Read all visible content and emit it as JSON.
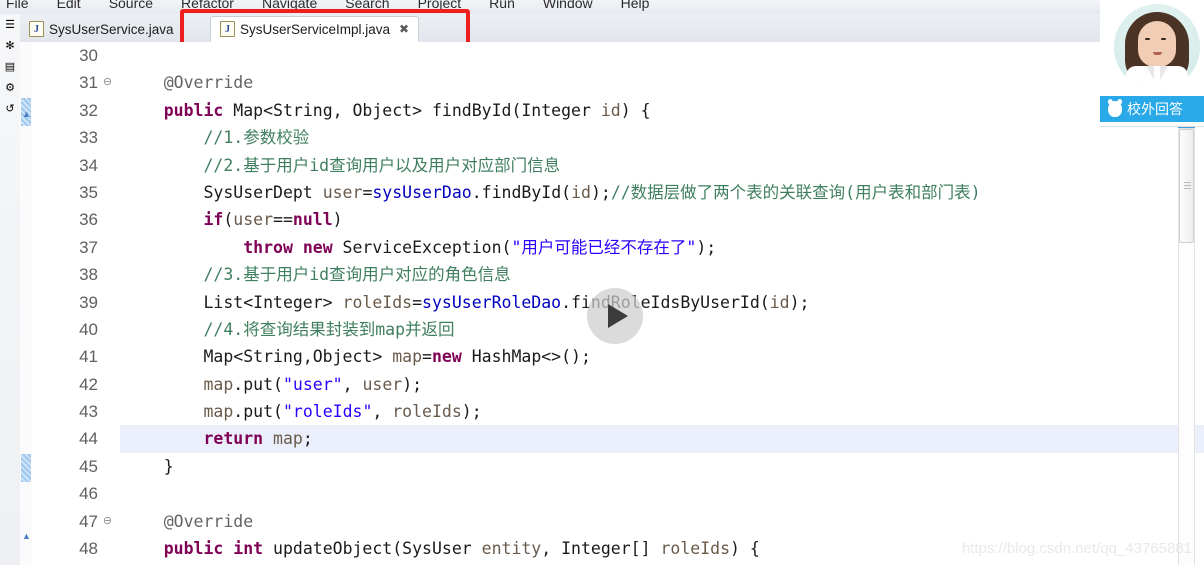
{
  "menubar": {
    "items": [
      "File",
      "Edit",
      "Source",
      "Refactor",
      "Navigate",
      "Search",
      "Project",
      "Run",
      "Window",
      "Help"
    ]
  },
  "rail": {
    "icons": [
      "package-explorer-icon",
      "bug-icon",
      "open-type-icon",
      "java-browsing-icon",
      "undo-icon"
    ],
    "glyphs": [
      "☰",
      "✻",
      "▤",
      "⚙",
      "↺"
    ]
  },
  "tabs": [
    {
      "label": "SysUserService.java",
      "icon": "java-file-icon",
      "icon_glyph": "J",
      "active": false,
      "closable": false
    },
    {
      "label": "SysUserServiceImpl.java",
      "icon": "java-file-icon",
      "icon_glyph": "J",
      "active": true,
      "closable": true,
      "close_glyph": "✖"
    }
  ],
  "annotation": {
    "highlight_color": "#ef1f1f",
    "target": "SysUserServiceImpl.java"
  },
  "editor": {
    "current_line": 44,
    "lines": [
      {
        "n": "30",
        "fold": "",
        "tokens": []
      },
      {
        "n": "31",
        "fold": "⊖",
        "tokens": [
          {
            "t": "    ",
            "c": "pln"
          },
          {
            "t": "@Override",
            "c": "ann"
          }
        ]
      },
      {
        "n": "32",
        "fold": "",
        "tokens": [
          {
            "t": "    ",
            "c": "pln"
          },
          {
            "t": "public",
            "c": "kw"
          },
          {
            "t": " Map<String, Object> findById(",
            "c": "pln"
          },
          {
            "t": "Integer",
            "c": "pln"
          },
          {
            "t": " ",
            "c": "pln"
          },
          {
            "t": "id",
            "c": "var"
          },
          {
            "t": ") {",
            "c": "pln"
          }
        ]
      },
      {
        "n": "33",
        "fold": "",
        "tokens": [
          {
            "t": "        ",
            "c": "pln"
          },
          {
            "t": "//1.参数校验",
            "c": "cm"
          }
        ]
      },
      {
        "n": "34",
        "fold": "",
        "tokens": [
          {
            "t": "        ",
            "c": "pln"
          },
          {
            "t": "//2.基于用户id查询用户以及用户对应部门信息",
            "c": "cm"
          }
        ]
      },
      {
        "n": "35",
        "fold": "",
        "tokens": [
          {
            "t": "        SysUserDept ",
            "c": "pln"
          },
          {
            "t": "user",
            "c": "var"
          },
          {
            "t": "=",
            "c": "pln"
          },
          {
            "t": "sysUserDao",
            "c": "fld"
          },
          {
            "t": ".findById(",
            "c": "pln"
          },
          {
            "t": "id",
            "c": "var"
          },
          {
            "t": ");",
            "c": "pln"
          },
          {
            "t": "//数据层做了两个表的关联查询(用户表和部门表)",
            "c": "cm"
          }
        ]
      },
      {
        "n": "36",
        "fold": "",
        "tokens": [
          {
            "t": "        ",
            "c": "pln"
          },
          {
            "t": "if",
            "c": "kw"
          },
          {
            "t": "(",
            "c": "pln"
          },
          {
            "t": "user",
            "c": "var"
          },
          {
            "t": "==",
            "c": "pln"
          },
          {
            "t": "null",
            "c": "kw"
          },
          {
            "t": ")",
            "c": "pln"
          }
        ]
      },
      {
        "n": "37",
        "fold": "",
        "tokens": [
          {
            "t": "            ",
            "c": "pln"
          },
          {
            "t": "throw new",
            "c": "kw"
          },
          {
            "t": " ServiceException(",
            "c": "pln"
          },
          {
            "t": "\"用户可能已经不存在了\"",
            "c": "str"
          },
          {
            "t": ");",
            "c": "pln"
          }
        ]
      },
      {
        "n": "38",
        "fold": "",
        "tokens": [
          {
            "t": "        ",
            "c": "pln"
          },
          {
            "t": "//3.基于用户id查询用户对应的角色信息",
            "c": "cm"
          }
        ]
      },
      {
        "n": "39",
        "fold": "",
        "tokens": [
          {
            "t": "        List<Integer> ",
            "c": "pln"
          },
          {
            "t": "roleIds",
            "c": "var"
          },
          {
            "t": "=",
            "c": "pln"
          },
          {
            "t": "sysUserRoleDao",
            "c": "fld"
          },
          {
            "t": ".findRoleIdsByUserId(",
            "c": "pln"
          },
          {
            "t": "id",
            "c": "var"
          },
          {
            "t": ");",
            "c": "pln"
          }
        ]
      },
      {
        "n": "40",
        "fold": "",
        "tokens": [
          {
            "t": "        ",
            "c": "pln"
          },
          {
            "t": "//4.将查询结果封装到map并返回",
            "c": "cm"
          }
        ]
      },
      {
        "n": "41",
        "fold": "",
        "tokens": [
          {
            "t": "        Map<String,Object> ",
            "c": "pln"
          },
          {
            "t": "map",
            "c": "var"
          },
          {
            "t": "=",
            "c": "pln"
          },
          {
            "t": "new",
            "c": "kw"
          },
          {
            "t": " HashMap<>();",
            "c": "pln"
          }
        ]
      },
      {
        "n": "42",
        "fold": "",
        "tokens": [
          {
            "t": "        ",
            "c": "pln"
          },
          {
            "t": "map",
            "c": "var"
          },
          {
            "t": ".put(",
            "c": "pln"
          },
          {
            "t": "\"user\"",
            "c": "str"
          },
          {
            "t": ", ",
            "c": "pln"
          },
          {
            "t": "user",
            "c": "var"
          },
          {
            "t": ");",
            "c": "pln"
          }
        ]
      },
      {
        "n": "43",
        "fold": "",
        "tokens": [
          {
            "t": "        ",
            "c": "pln"
          },
          {
            "t": "map",
            "c": "var"
          },
          {
            "t": ".put(",
            "c": "pln"
          },
          {
            "t": "\"roleIds\"",
            "c": "str"
          },
          {
            "t": ", ",
            "c": "pln"
          },
          {
            "t": "roleIds",
            "c": "var"
          },
          {
            "t": ");",
            "c": "pln"
          }
        ]
      },
      {
        "n": "44",
        "fold": "",
        "tokens": [
          {
            "t": "        ",
            "c": "pln"
          },
          {
            "t": "return",
            "c": "kw"
          },
          {
            "t": " ",
            "c": "pln"
          },
          {
            "t": "map",
            "c": "var"
          },
          {
            "t": ";",
            "c": "pln"
          }
        ]
      },
      {
        "n": "45",
        "fold": "",
        "tokens": [
          {
            "t": "    }",
            "c": "pln"
          }
        ]
      },
      {
        "n": "46",
        "fold": "",
        "tokens": []
      },
      {
        "n": "47",
        "fold": "⊖",
        "tokens": [
          {
            "t": "    ",
            "c": "pln"
          },
          {
            "t": "@Override",
            "c": "ann"
          }
        ]
      },
      {
        "n": "48",
        "fold": "",
        "tokens": [
          {
            "t": "    ",
            "c": "pln"
          },
          {
            "t": "public int",
            "c": "kw"
          },
          {
            "t": " updateObject(SysUser ",
            "c": "pln"
          },
          {
            "t": "entity",
            "c": "var"
          },
          {
            "t": ", Integer[] ",
            "c": "pln"
          },
          {
            "t": "roleIds",
            "c": "var"
          },
          {
            "t": ") {",
            "c": "pln"
          }
        ]
      }
    ]
  },
  "overlay": {
    "play_button": "play-icon"
  },
  "chat_widget": {
    "avatar": "woman-avatar",
    "bar_label": "校外回答",
    "bar_color": "#29a9e8",
    "qq_icon": "qq-penguin-icon"
  },
  "watermark": {
    "text": "https://blog.csdn.net/qq_43765881"
  },
  "colors": {
    "keyword": "#7f0055",
    "comment": "#3f7f5f",
    "string": "#2a00ff",
    "field": "#0000c0",
    "annotation": "#646464",
    "current_line": "#eaeffb",
    "tab_highlight": "#ef1f1f"
  }
}
